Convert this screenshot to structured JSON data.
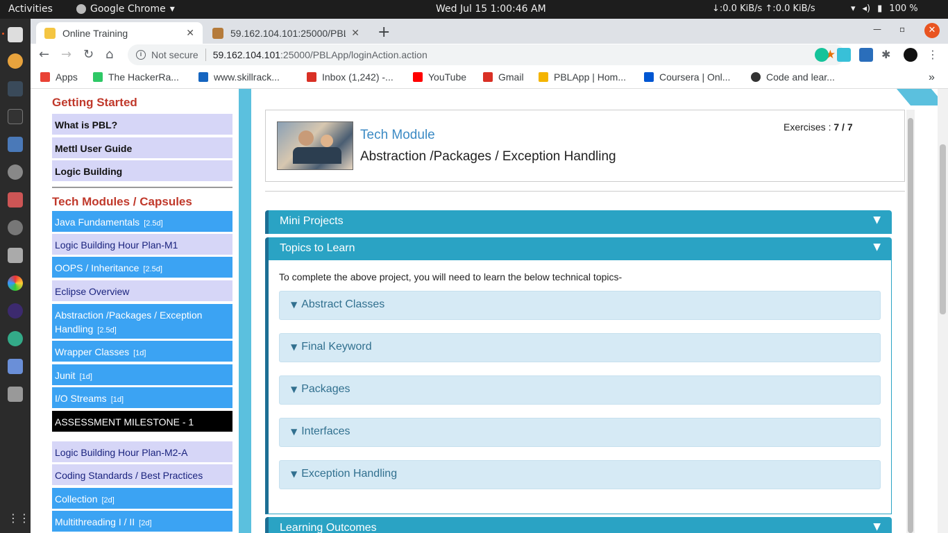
{
  "topbar": {
    "activities": "Activities",
    "app_name": "Google Chrome",
    "app_menu_arrow": "▾",
    "datetime": "Wed Jul 15   1:00:46 AM",
    "network": "↓:0.0 KiB/s  ↑:0.0 KiB/s",
    "battery": "100 %"
  },
  "tabs": [
    {
      "title": "Online Training",
      "close": "✕"
    },
    {
      "title": "59.162.104.101:25000/PBL",
      "close": "✕"
    }
  ],
  "new_tab": "+",
  "address": {
    "info": "i",
    "not_secure": "Not secure",
    "host": "59.162.104.101",
    "path": ":25000/PBLApp/loginAction.action"
  },
  "bookmarks": [
    {
      "label": "Apps",
      "color": "#e94235"
    },
    {
      "label": "The HackerRa...",
      "color": "#2ec866"
    },
    {
      "label": "www.skillrack...",
      "color": "#1565c0"
    },
    {
      "label": "Inbox (1,242) -...",
      "color": "#d93025"
    },
    {
      "label": "YouTube",
      "color": "#ff0000"
    },
    {
      "label": "Gmail",
      "color": "#d93025"
    },
    {
      "label": "PBLApp | Hom...",
      "color": "#f4b400"
    },
    {
      "label": "Coursera | Onl...",
      "color": "#0056d2"
    },
    {
      "label": "Code and lear...",
      "color": "#333333"
    }
  ],
  "bookmarks_more": "»",
  "sidebar": {
    "section1": "Getting Started",
    "getting_started": [
      {
        "label": "What is PBL?"
      },
      {
        "label": "Mettl User Guide"
      },
      {
        "label": "Logic Building"
      }
    ],
    "section2": "Tech Modules / Capsules",
    "modules": [
      {
        "label": "Java Fundamentals",
        "dur": "[2.5d]"
      },
      {
        "label": "Logic Building Hour Plan-M1",
        "dur": ""
      },
      {
        "label": "OOPS / Inheritance",
        "dur": "[2.5d]"
      },
      {
        "label": "Eclipse Overview",
        "dur": ""
      },
      {
        "label": "Abstraction /Packages / Exception Handling",
        "dur": "[2.5d]"
      },
      {
        "label": "Wrapper Classes",
        "dur": "[1d]"
      },
      {
        "label": "Junit",
        "dur": "[1d]"
      },
      {
        "label": "I/O Streams",
        "dur": "[1d]"
      },
      {
        "label": "ASSESSMENT MILESTONE - 1",
        "dur": ""
      },
      {
        "label": "Logic Building Hour Plan-M2-A",
        "dur": ""
      },
      {
        "label": "Coding Standards / Best Practices",
        "dur": ""
      },
      {
        "label": "Collection",
        "dur": "[2d]"
      },
      {
        "label": "Multithreading I / II",
        "dur": "[2d]"
      }
    ]
  },
  "module_card": {
    "title": "Tech Module",
    "subtitle": "Abstraction /Packages / Exception Handling",
    "exercises_label": "Exercises : ",
    "exercises_value": "7 / 7"
  },
  "panels": {
    "mini_projects": "Mini Projects",
    "topics_to_learn": "Topics to Learn",
    "learning_outcomes": "Learning Outcomes",
    "chevron": "⌄"
  },
  "topics": {
    "intro": "To complete the above project, you will need to learn the below technical topics-",
    "items": [
      "Abstract Classes",
      "Final Keyword",
      "Packages",
      "Interfaces",
      "Exception Handling"
    ],
    "chevron": "❯"
  }
}
